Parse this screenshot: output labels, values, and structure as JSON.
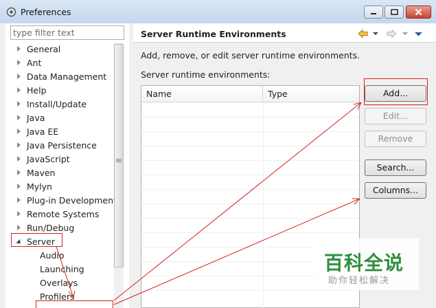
{
  "window": {
    "title": "Preferences"
  },
  "filter": {
    "placeholder": "type filter text"
  },
  "tree": {
    "items": [
      {
        "label": "General",
        "expanded": false
      },
      {
        "label": "Ant",
        "expanded": false
      },
      {
        "label": "Data Management",
        "expanded": false
      },
      {
        "label": "Help",
        "expanded": false
      },
      {
        "label": "Install/Update",
        "expanded": false
      },
      {
        "label": "Java",
        "expanded": false
      },
      {
        "label": "Java EE",
        "expanded": false
      },
      {
        "label": "Java Persistence",
        "expanded": false
      },
      {
        "label": "JavaScript",
        "expanded": false
      },
      {
        "label": "Maven",
        "expanded": false
      },
      {
        "label": "Mylyn",
        "expanded": false
      },
      {
        "label": "Plug-in Development",
        "expanded": false
      },
      {
        "label": "Remote Systems",
        "expanded": false
      },
      {
        "label": "Run/Debug",
        "expanded": false
      },
      {
        "label": "Server",
        "expanded": true
      }
    ],
    "children": [
      {
        "label": "Audio"
      },
      {
        "label": "Launching"
      },
      {
        "label": "Overlays"
      },
      {
        "label": "Profilers"
      }
    ]
  },
  "page": {
    "title": "Server Runtime Environments",
    "description": "Add, remove, or edit server runtime environments.",
    "table_label": "Server runtime environments:"
  },
  "table": {
    "columns": [
      "Name",
      "Type"
    ],
    "rows": []
  },
  "buttons": {
    "add": "Add...",
    "edit": "Edit...",
    "remove": "Remove",
    "search": "Search...",
    "columns": "Columns..."
  },
  "watermark": {
    "title": "百科全说",
    "subtitle": "助你轻松解决"
  },
  "colors": {
    "annotation": "#d81e1e",
    "watermark": "#2f8f3e",
    "nav_arrow": "#e8a317"
  }
}
